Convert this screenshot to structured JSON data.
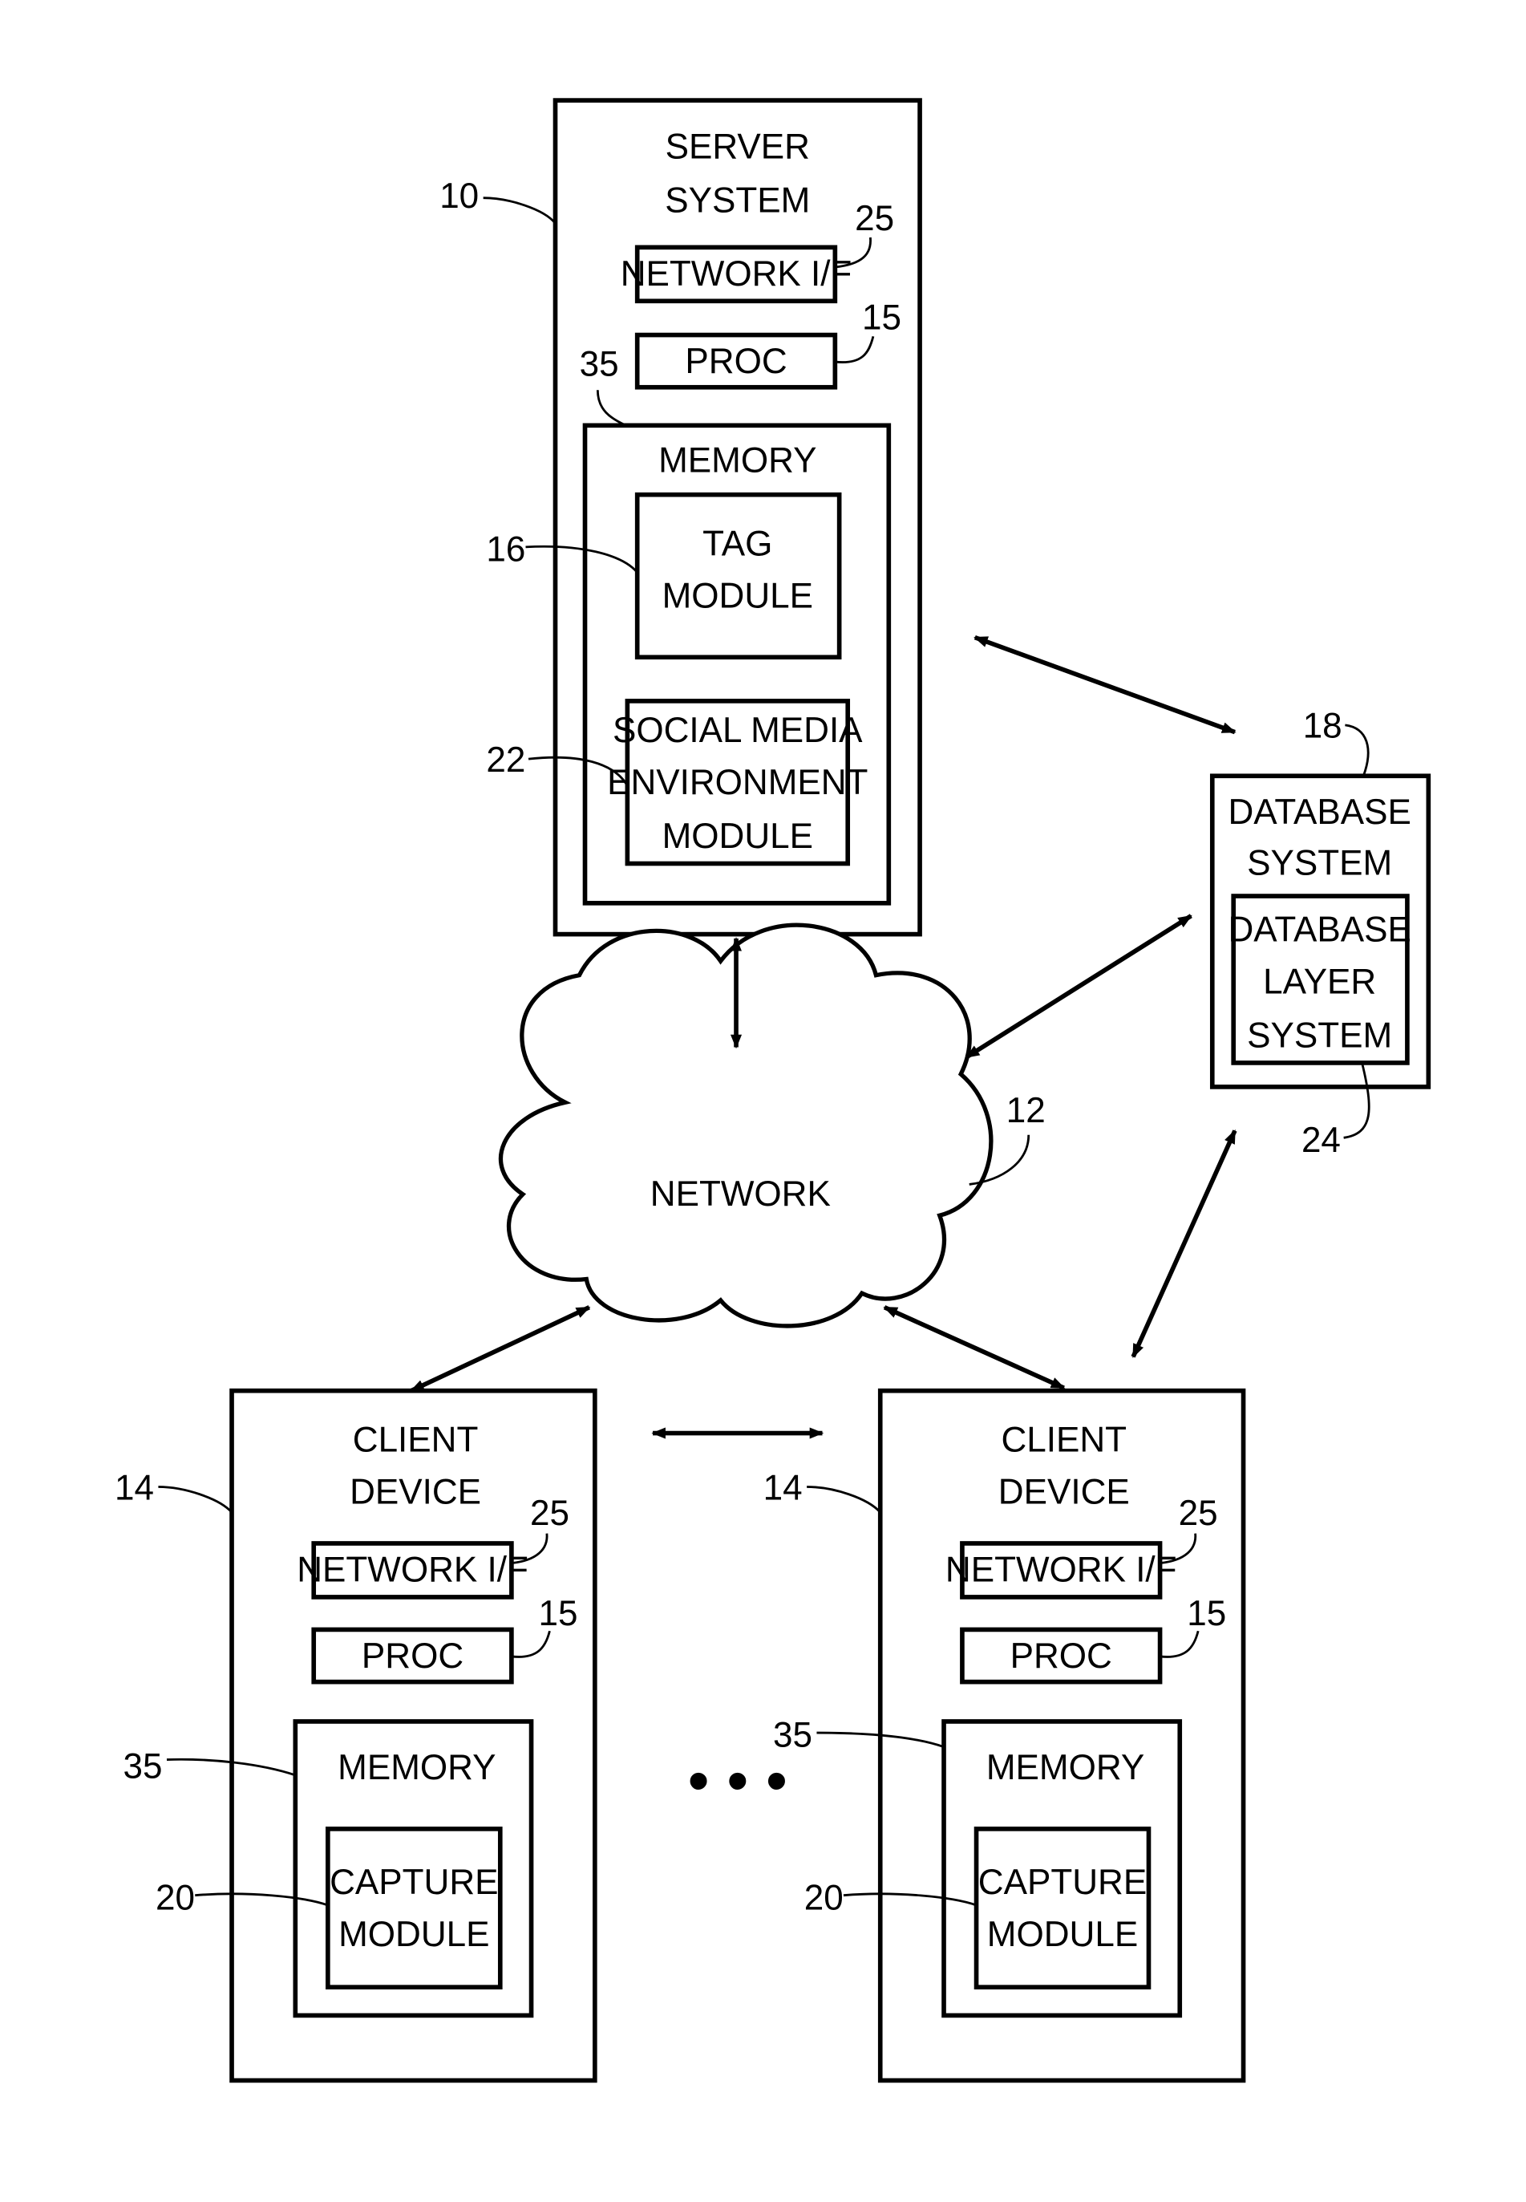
{
  "diagram": {
    "server": {
      "title": [
        "SERVER",
        "SYSTEM"
      ],
      "ref": "10",
      "network_if": {
        "label": "NETWORK I/F",
        "ref": "25"
      },
      "proc": {
        "label": "PROC",
        "ref": "15"
      },
      "memory": {
        "label": "MEMORY",
        "ref": "35",
        "tag_module": {
          "label": [
            "TAG",
            "MODULE"
          ],
          "ref": "16"
        },
        "social_module": {
          "label": [
            "SOCIAL MEDIA",
            "ENVIRONMENT",
            "MODULE"
          ],
          "ref": "22"
        }
      }
    },
    "database": {
      "title": [
        "DATABASE",
        "SYSTEM"
      ],
      "ref": "18",
      "layer": {
        "label": [
          "DATABASE",
          "LAYER",
          "SYSTEM"
        ],
        "ref": "24"
      }
    },
    "network": {
      "label": "NETWORK",
      "ref": "12"
    },
    "clients": [
      {
        "title": [
          "CLIENT",
          "DEVICE"
        ],
        "ref": "14",
        "network_if": {
          "label": "NETWORK I/F",
          "ref": "25"
        },
        "proc": {
          "label": "PROC",
          "ref": "15"
        },
        "memory": {
          "label": "MEMORY",
          "ref": "35",
          "capture_module": {
            "label": [
              "CAPTURE",
              "MODULE"
            ],
            "ref": "20"
          }
        }
      },
      {
        "title": [
          "CLIENT",
          "DEVICE"
        ],
        "ref": "14",
        "network_if": {
          "label": "NETWORK I/F",
          "ref": "25"
        },
        "proc": {
          "label": "PROC",
          "ref": "15"
        },
        "memory": {
          "label": "MEMORY",
          "ref": "35",
          "capture_module": {
            "label": [
              "CAPTURE",
              "MODULE"
            ],
            "ref": "20"
          }
        }
      }
    ],
    "ellipsis": "• • •"
  }
}
